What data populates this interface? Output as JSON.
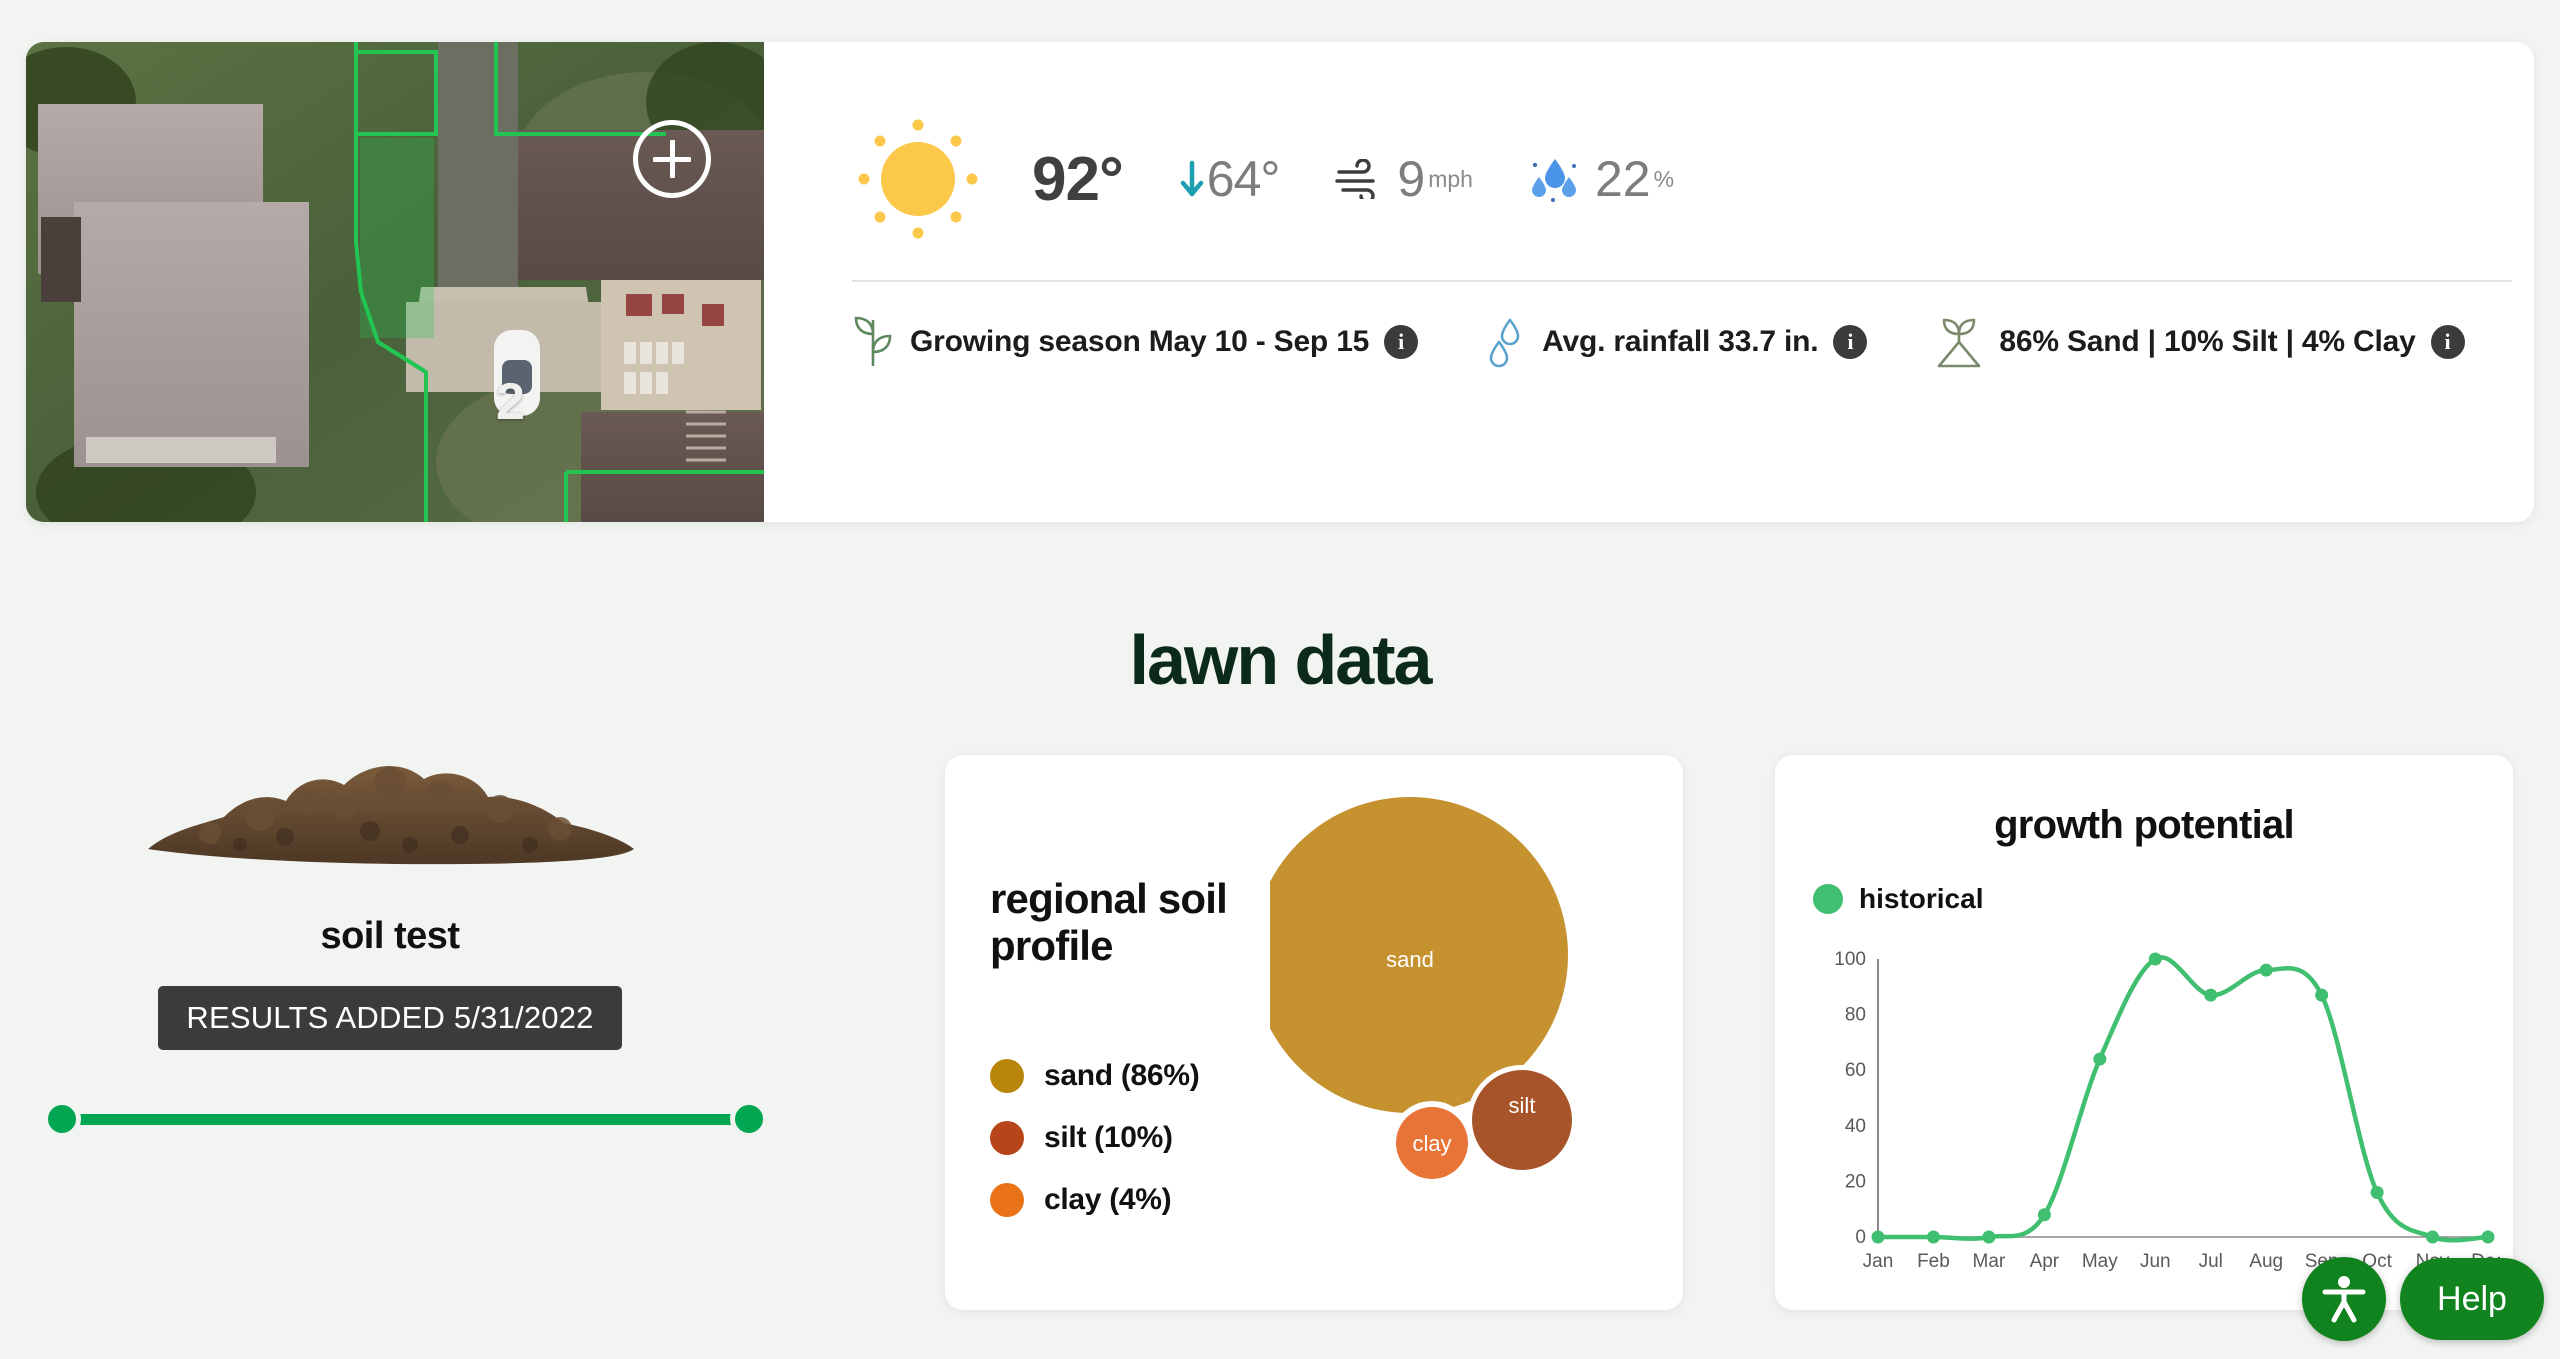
{
  "map": {
    "zone_label": "2",
    "add_zone_icon": "plus-circle-icon"
  },
  "weather": {
    "condition_icon": "sun-icon",
    "high_temp": "92°",
    "low_temp_arrow_icon": "arrow-down-icon",
    "low_temp": "64°",
    "wind_icon": "wind-icon",
    "wind_speed": "9",
    "wind_unit": "mph",
    "humidity_icon": "water-drops-icon",
    "humidity": "22",
    "humidity_unit": "%"
  },
  "info_row": [
    {
      "icon": "leaf-sprout-icon",
      "text": "Growing season May 10 - Sep 15",
      "badge": "i"
    },
    {
      "icon": "raindrops-icon",
      "text": "Avg. rainfall 33.7 in.",
      "badge": "i"
    },
    {
      "icon": "soil-sprout-icon",
      "text": "86% Sand | 10% Silt | 4% Clay",
      "badge": "i"
    }
  ],
  "section": {
    "title": "lawn data"
  },
  "soil_test": {
    "image_icon": "soil-pile-icon",
    "title": "soil test",
    "results_chip": "RESULTS ADDED 5/31/2022"
  },
  "soil_profile": {
    "title": "regional soil profile",
    "legend": [
      {
        "label": "sand (86%)",
        "color": "#b8860b"
      },
      {
        "label": "silt (10%)",
        "color": "#b8441a"
      },
      {
        "label": "clay (4%)",
        "color": "#ea7317"
      }
    ]
  },
  "growth": {
    "title": "growth potential",
    "legend_label": "historical",
    "legend_color": "#3fbf6f"
  },
  "floating": {
    "accessibility_icon": "accessibility-person-icon",
    "help_label": "Help",
    "accent_green": "#11841f"
  },
  "chart_data": [
    {
      "type": "pie",
      "title": "regional soil profile",
      "categories": [
        "sand",
        "silt",
        "clay"
      ],
      "values": [
        86,
        10,
        4
      ],
      "labels": [
        "sand (86%)",
        "silt (10%)",
        "clay (4%)"
      ],
      "colors": [
        "#c6912f",
        "#a8542a",
        "#e87438"
      ],
      "bubble_labels": [
        "sand",
        "silt",
        "clay"
      ],
      "legend": "left"
    },
    {
      "type": "line",
      "title": "growth potential",
      "xlabel": "",
      "ylabel": "",
      "ylim": [
        0,
        100
      ],
      "yticks": [
        0,
        20,
        40,
        60,
        80,
        100
      ],
      "categories": [
        "Jan",
        "Feb",
        "Mar",
        "Apr",
        "May",
        "Jun",
        "Jul",
        "Aug",
        "Sep",
        "Oct",
        "Nov",
        "Dec"
      ],
      "series": [
        {
          "name": "historical",
          "color": "#3fbf6f",
          "values": [
            0,
            0,
            0,
            8,
            64,
            100,
            87,
            96,
            87,
            16,
            0,
            0
          ]
        }
      ],
      "grid": false,
      "legend": "top-left"
    }
  ]
}
